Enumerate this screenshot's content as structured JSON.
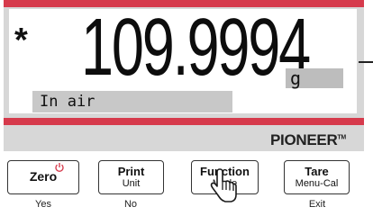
{
  "display": {
    "stable_indicator": "*",
    "reading": "109.9994",
    "unit": "g",
    "status": "In air"
  },
  "brand": {
    "name": "PIONEER",
    "trademark": "TM"
  },
  "keys": {
    "zero": {
      "main": "Zero",
      "below": "Yes"
    },
    "print": {
      "main": "Print",
      "sub": "Unit",
      "below": "No"
    },
    "function": {
      "main": "Function",
      "sub": "Mode"
    },
    "tare": {
      "main": "Tare",
      "sub": "Menu-Cal",
      "below": "Exit"
    }
  },
  "icons": {
    "power": "power-icon",
    "pointer": "hand-pointer-icon"
  },
  "colors": {
    "accent_red": "#d63a4c",
    "display_gray": "#d7d7d7",
    "unit_box": "#bdbdbd",
    "status_box": "#c8c8c8"
  }
}
